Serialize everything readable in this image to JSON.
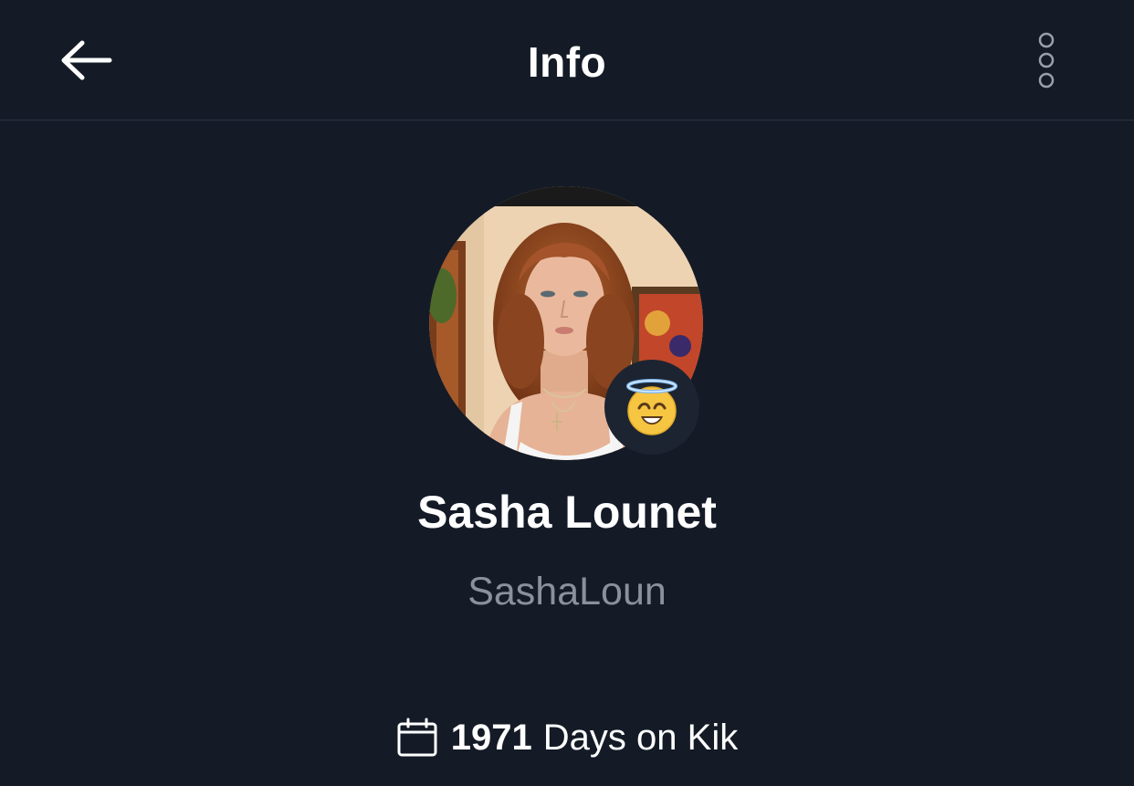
{
  "header": {
    "title": "Info",
    "back_icon": "arrow-left-icon",
    "more_icon": "more-vertical-icon"
  },
  "profile": {
    "display_name": "Sasha Lounet",
    "username": "SashaLoun",
    "avatar": "profile-photo",
    "mood_emoji": "smiling-face-with-halo",
    "days_count": "1971",
    "days_suffix": "Days on Kik",
    "days_icon": "calendar-icon"
  },
  "colors": {
    "background": "#141b27",
    "divider": "#2c3441",
    "text_primary": "#ffffff",
    "text_secondary": "#8a919c",
    "badge_bg": "#1c2431"
  }
}
